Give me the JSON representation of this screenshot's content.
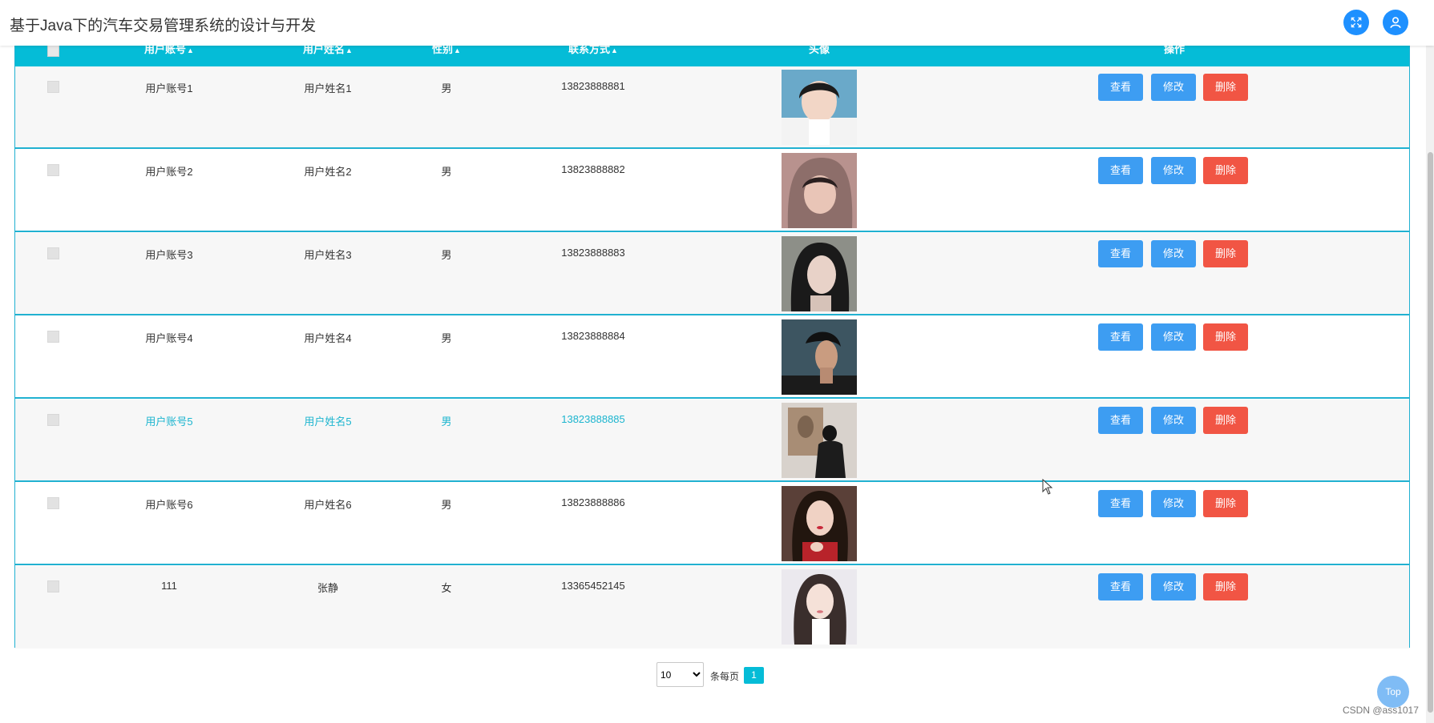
{
  "app": {
    "title": "基于Java下的汽车交易管理系统的设计与开发"
  },
  "icons": {
    "fullscreen": "fullscreen-icon",
    "user": "user-icon",
    "sort": "sort-icon"
  },
  "table": {
    "headers": {
      "account": "用户账号",
      "name": "用户姓名",
      "gender": "性别",
      "contact": "联系方式",
      "avatar": "头像",
      "actions": "操作"
    },
    "rows": [
      {
        "account": "用户账号1",
        "name": "用户姓名1",
        "gender": "男",
        "contact": "13823888881"
      },
      {
        "account": "用户账号2",
        "name": "用户姓名2",
        "gender": "男",
        "contact": "13823888882"
      },
      {
        "account": "用户账号3",
        "name": "用户姓名3",
        "gender": "男",
        "contact": "13823888883"
      },
      {
        "account": "用户账号4",
        "name": "用户姓名4",
        "gender": "男",
        "contact": "13823888884"
      },
      {
        "account": "用户账号5",
        "name": "用户姓名5",
        "gender": "男",
        "contact": "13823888885"
      },
      {
        "account": "用户账号6",
        "name": "用户姓名6",
        "gender": "男",
        "contact": "13823888886"
      },
      {
        "account": "111",
        "name": "张静",
        "gender": "女",
        "contact": "13365452145"
      }
    ],
    "actions": {
      "view": "查看",
      "edit": "修改",
      "delete": "删除"
    }
  },
  "pagination": {
    "page_size": "10",
    "per_page_label": "条每页",
    "current_page": "1"
  },
  "top_button": "Top",
  "watermark": "CSDN @ass1017",
  "colors": {
    "accent": "#05bcd7",
    "primary": "#3d9df2",
    "danger": "#f15544",
    "highlight": "#1cb5cf"
  }
}
